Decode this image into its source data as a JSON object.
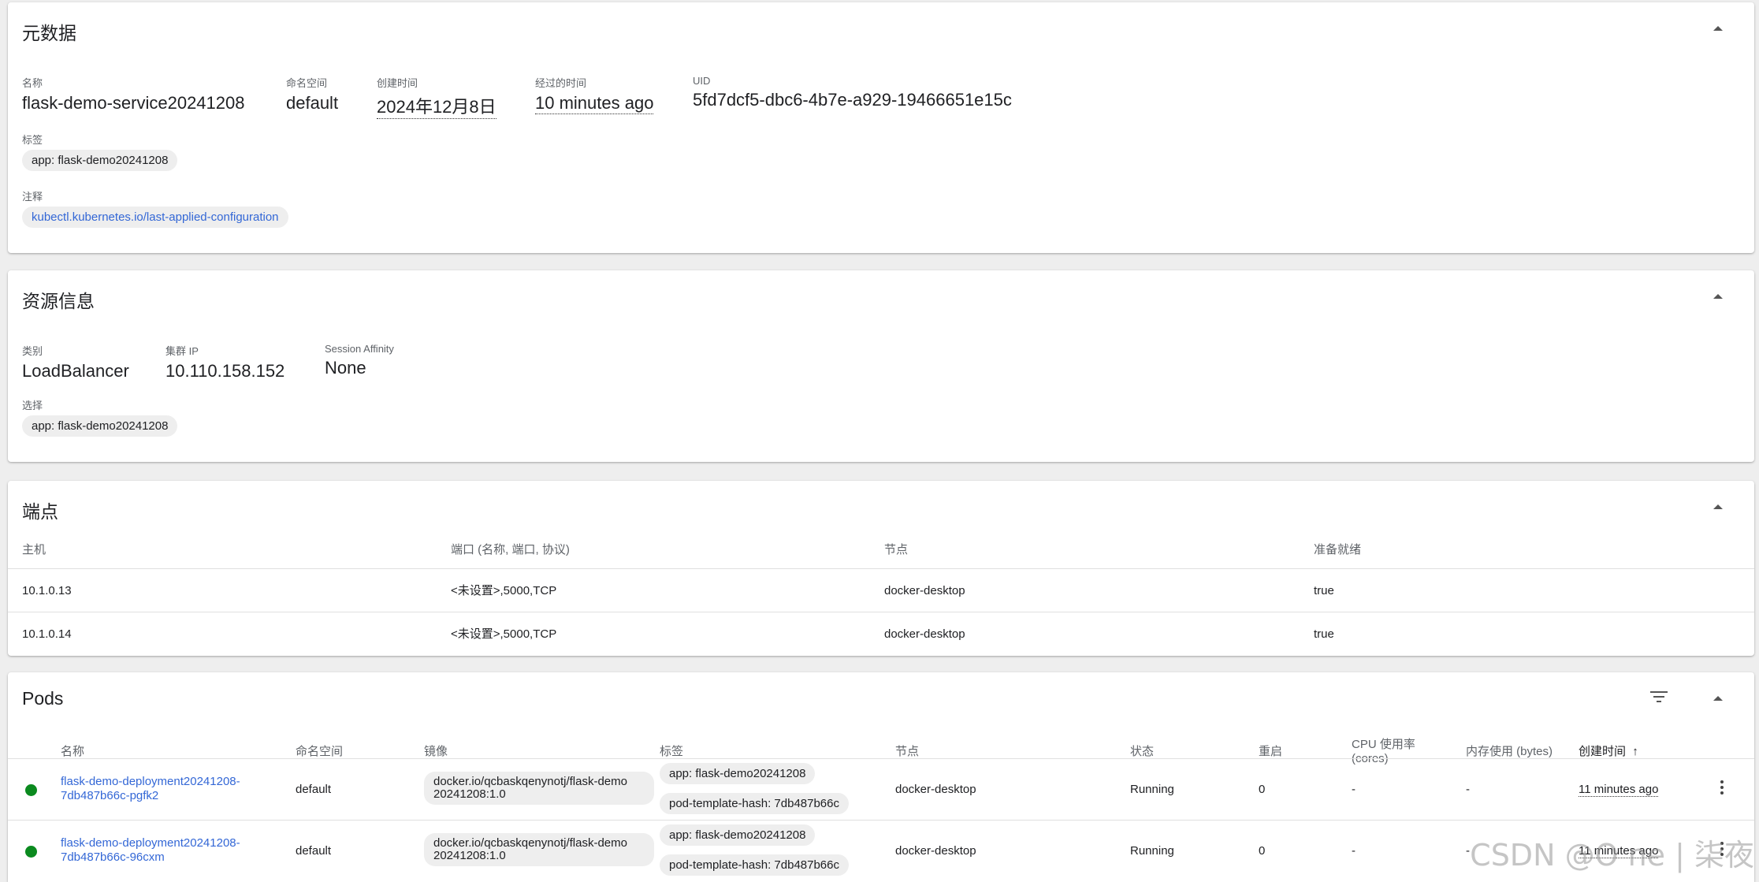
{
  "metadata": {
    "title": "元数据",
    "name_label": "名称",
    "name_value": "flask-demo-service20241208",
    "namespace_label": "命名空间",
    "namespace_value": "default",
    "created_label": "创建时间",
    "created_value": "2024年12月8日",
    "age_label": "经过的时间",
    "age_value": "10 minutes ago",
    "uid_label": "UID",
    "uid_value": "5fd7dcf5-dbc6-4b7e-a929-19466651e15c",
    "labels_label": "标签",
    "labels": [
      "app: flask-demo20241208"
    ],
    "annotations_label": "注释",
    "annotations": [
      "kubectl.kubernetes.io/last-applied-configuration"
    ]
  },
  "resource": {
    "title": "资源信息",
    "type_label": "类别",
    "type_value": "LoadBalancer",
    "cluster_ip_label": "集群 IP",
    "cluster_ip_value": "10.110.158.152",
    "session_affinity_label": "Session Affinity",
    "session_affinity_value": "None",
    "selector_label": "选择",
    "selector": [
      "app: flask-demo20241208"
    ]
  },
  "endpoints": {
    "title": "端点",
    "columns": [
      "主机",
      "端口 (名称, 端口, 协议)",
      "节点",
      "准备就绪"
    ],
    "rows": [
      [
        "10.1.0.13",
        "<未设置>,5000,TCP",
        "docker-desktop",
        "true"
      ],
      [
        "10.1.0.14",
        "<未设置>,5000,TCP",
        "docker-desktop",
        "true"
      ]
    ]
  },
  "pods": {
    "title": "Pods",
    "columns": {
      "name": "名称",
      "namespace": "命名空间",
      "image": "镜像",
      "labels": "标签",
      "node": "节点",
      "status": "状态",
      "restarts": "重启",
      "cpu_line1": "CPU 使用率",
      "cpu_line2": "(cores)",
      "memory": "内存使用 (bytes)",
      "created": "创建时间",
      "sort_arrow": "↑"
    },
    "rows": [
      {
        "name_line1": "flask-demo-deployment20241208-",
        "name_line2": "7db487b66c-pgfk2",
        "namespace": "default",
        "image_line1": "docker.io/qcbaskqenynotj/flask-demo",
        "image_line2": "20241208:1.0",
        "label1": "app: flask-demo20241208",
        "label2": "pod-template-hash: 7db487b66c",
        "node": "docker-desktop",
        "status": "Running",
        "restarts": "0",
        "cpu": "-",
        "memory": "-",
        "created": "11 minutes ago"
      },
      {
        "name_line1": "flask-demo-deployment20241208-",
        "name_line2": "7db487b66c-96cxm",
        "namespace": "default",
        "image_line1": "docker.io/qcbaskqenynotj/flask-demo",
        "image_line2": "20241208:1.0",
        "label1": "app: flask-demo20241208",
        "label2": "pod-template-hash: 7db487b66c",
        "node": "docker-desktop",
        "status": "Running",
        "restarts": "0",
        "cpu": "-",
        "memory": "-",
        "created": "11 minutes ago"
      }
    ]
  },
  "watermark": "CSDN @O   ne | 柒夜",
  "colors": {
    "accent_link": "#3367d6",
    "status_running": "#0b8a1f",
    "page_bg": "#eeeeee",
    "chip_bg": "#eeeeee"
  },
  "icons": [
    "collapse-up-icon",
    "filter-icon",
    "more-vert-icon",
    "status-dot-icon",
    "sort-arrow-icon"
  ]
}
